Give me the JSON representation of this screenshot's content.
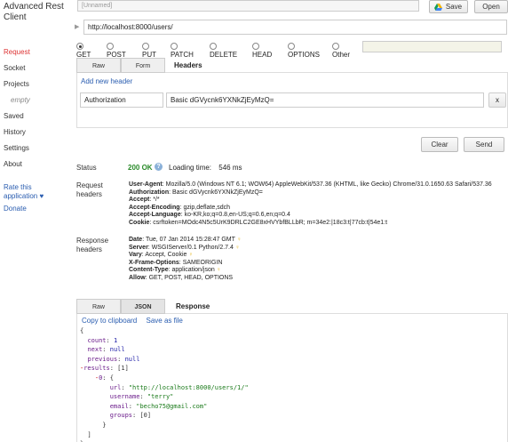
{
  "app": {
    "title": "Advanced Rest Client"
  },
  "sidebar": {
    "items": [
      {
        "label": "Request",
        "active": true
      },
      {
        "label": "Socket"
      },
      {
        "label": "Projects"
      },
      {
        "label": "empty",
        "sub": true
      },
      {
        "label": "Saved"
      },
      {
        "label": "History"
      },
      {
        "label": "Settings"
      },
      {
        "label": "About"
      }
    ],
    "rate_label": "Rate this application ♥",
    "donate_label": "Donate"
  },
  "topbar": {
    "project_placeholder": "[Unnamed]",
    "save_label": "Save",
    "open_label": "Open"
  },
  "request": {
    "url": "http://localhost:8000/users/",
    "methods": [
      "GET",
      "POST",
      "PUT",
      "PATCH",
      "DELETE",
      "HEAD",
      "OPTIONS",
      "Other"
    ],
    "selected_method": "GET",
    "tabs": {
      "raw": "Raw",
      "form": "Form",
      "headers": "Headers"
    },
    "add_header_label": "Add new header",
    "header_name": "Authorization",
    "header_value": "Basic dGVycnk6YXNkZjEyMzQ=",
    "remove_label": "x",
    "clear_label": "Clear",
    "send_label": "Send"
  },
  "status": {
    "label": "Status",
    "code": "200 OK",
    "loading_label": "Loading time:",
    "loading_value": "546 ms"
  },
  "request_headers": {
    "label": "Request headers",
    "items": [
      {
        "key": "User-Agent",
        "value": "Mozilla/5.0 (Windows NT 6.1; WOW64) AppleWebKit/537.36 (KHTML, like Gecko) Chrome/31.0.1650.63 Safari/537.36"
      },
      {
        "key": "Authorization",
        "value": "Basic dGVycnk6YXNkZjEyMzQ="
      },
      {
        "key": "Accept",
        "value": "*/*"
      },
      {
        "key": "Accept-Encoding",
        "value": "gzip,deflate,sdch"
      },
      {
        "key": "Accept-Language",
        "value": "ko-KR,ko;q=0.8,en-US;q=0.6,en;q=0.4"
      },
      {
        "key": "Cookie",
        "value": "csrftoken=MOdc4N5c5UrK9DRLC2GE8xHVYbfBLLbR; m=34e2:|18c3:t|77cb:t|54e1:t"
      }
    ]
  },
  "response_headers": {
    "label": "Response headers",
    "items": [
      {
        "key": "Date",
        "value": "Tue, 07 Jan 2014 15:28:47 GMT"
      },
      {
        "key": "Server",
        "value": "WSGIServer/0.1 Python/2.7.4"
      },
      {
        "key": "Vary",
        "value": "Accept, Cookie"
      },
      {
        "key": "X-Frame-Options",
        "value": "SAMEORIGIN"
      },
      {
        "key": "Content-Type",
        "value": "application/json"
      },
      {
        "key": "Allow",
        "value": "GET, POST, HEAD, OPTIONS"
      }
    ]
  },
  "response": {
    "tabs": {
      "raw": "Raw",
      "json": "JSON",
      "response": "Response"
    },
    "copy_label": "Copy to clipboard",
    "save_label": "Save as file",
    "json_lines": [
      {
        "indent": 0,
        "text": "{"
      },
      {
        "indent": 1,
        "key": "count",
        "value": "1",
        "type": "num"
      },
      {
        "indent": 1,
        "key": "next",
        "value": "null",
        "type": "null"
      },
      {
        "indent": 1,
        "key": "previous",
        "value": "null",
        "type": "null"
      },
      {
        "indent": 0,
        "toggle": "-",
        "key": "results",
        "value": "[1]",
        "type": "plain"
      },
      {
        "indent": 2,
        "toggle": "-",
        "key": "0",
        "value": "{",
        "type": "plain"
      },
      {
        "indent": 4,
        "key": "url",
        "value": "\"http://localhost:8000/users/1/\"",
        "type": "str"
      },
      {
        "indent": 4,
        "key": "username",
        "value": "\"terry\"",
        "type": "str"
      },
      {
        "indent": 4,
        "key": "email",
        "value": "\"becho75@gmail.com\"",
        "type": "str"
      },
      {
        "indent": 4,
        "key": "groups",
        "value": "[0]",
        "type": "plain"
      },
      {
        "indent": 3,
        "text": "}"
      },
      {
        "indent": 1,
        "text": "]"
      },
      {
        "indent": 0,
        "text": "}"
      }
    ]
  }
}
